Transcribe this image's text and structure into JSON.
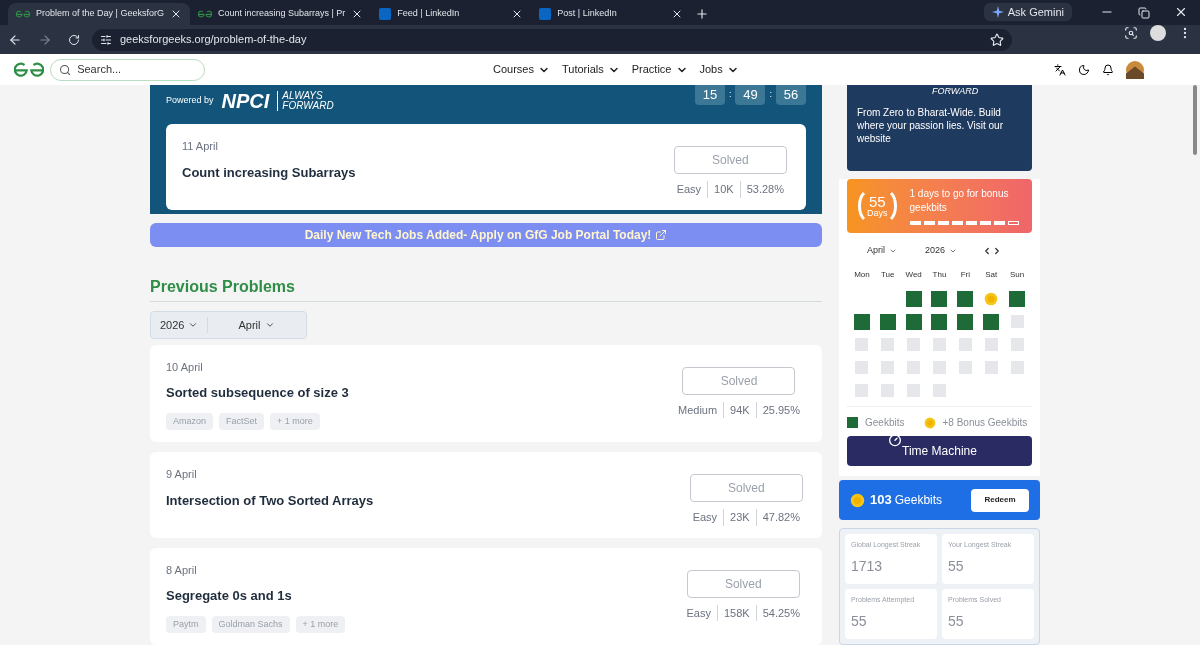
{
  "browser": {
    "tabs": [
      {
        "title": "Problem of the Day | GeeksforG",
        "kind": "gfg",
        "selected": true
      },
      {
        "title": "Count increasing Subarrays | Pr",
        "kind": "gfg",
        "selected": false
      },
      {
        "title": "Feed | LinkedIn",
        "kind": "linkedin",
        "selected": false
      },
      {
        "title": "Post | LinkedIn",
        "kind": "linkedin",
        "selected": false
      }
    ],
    "ask_gemini": "Ask Gemini",
    "address": "geeksforgeeks.org/problem-of-the-day"
  },
  "nav": {
    "search": {
      "placeholder": "Search..."
    },
    "menu": [
      "Courses",
      "Tutorials",
      "Practice",
      "Jobs"
    ]
  },
  "banner": {
    "powered_by": "Powered by",
    "sponsor": "NPCI",
    "tagline": [
      "ALWAYS",
      "FORWARD"
    ],
    "timer": [
      "15",
      "49",
      "56"
    ],
    "timer_separators": [
      ":",
      ":"
    ],
    "today": {
      "date": "11 April",
      "title": "Count increasing Subarrays",
      "status": "Solved",
      "stats": [
        "Easy",
        "10K",
        "53.28%"
      ]
    }
  },
  "jobs_banner": "Daily New Tech Jobs Added- Apply on GfG Job Portal Today!",
  "previous": {
    "heading": "Previous Problems",
    "year": "2026",
    "month": "April",
    "problems": [
      {
        "date": "10 April",
        "title": "Sorted subsequence of size 3",
        "tags": [
          "Amazon",
          "FactSet",
          "+ 1 more"
        ],
        "status": "Solved",
        "stats": [
          "Medium",
          "94K",
          "25.95%"
        ]
      },
      {
        "date": "9 April",
        "title": "Intersection of Two Sorted Arrays",
        "status": "Solved",
        "stats": [
          "Easy",
          "23K",
          "47.82%"
        ]
      },
      {
        "date": "8 April",
        "title": "Segregate 0s and 1s",
        "tags": [
          "Paytm",
          "Goldman Sachs",
          "+ 1 more"
        ],
        "status": "Solved",
        "stats": [
          "Easy",
          "158K",
          "54.25%"
        ]
      }
    ]
  },
  "ad": {
    "logo_text": "FORWARD",
    "text": "From Zero to Bharat-Wide. Build where your passion lies. Visit our website"
  },
  "streak": {
    "count": "55",
    "unit": "Days",
    "message": "1 days to go for bonus geekbits",
    "segments": [
      {
        "filled": true
      },
      {
        "filled": true
      },
      {
        "filled": true
      },
      {
        "filled": true
      },
      {
        "filled": true
      },
      {
        "filled": true
      },
      {
        "filled": true
      },
      {
        "filled": false
      }
    ]
  },
  "calendar": {
    "month": "April",
    "year": "2026",
    "weekdays": [
      "Mon",
      "Tue",
      "Wed",
      "Thu",
      "Fri",
      "Sat",
      "Sun"
    ],
    "days": [
      {
        "kind": "blank"
      },
      {
        "kind": "blank"
      },
      {
        "kind": "geekbit"
      },
      {
        "kind": "geekbit"
      },
      {
        "kind": "geekbit"
      },
      {
        "kind": "bonus"
      },
      {
        "kind": "geekbit"
      },
      {
        "kind": "geekbit"
      },
      {
        "kind": "geekbit"
      },
      {
        "kind": "geekbit"
      },
      {
        "kind": "geekbit"
      },
      {
        "kind": "geekbit"
      },
      {
        "kind": "geekbit"
      },
      {
        "kind": "none"
      },
      {
        "kind": "none"
      },
      {
        "kind": "none"
      },
      {
        "kind": "none"
      },
      {
        "kind": "none"
      },
      {
        "kind": "none"
      },
      {
        "kind": "none"
      },
      {
        "kind": "none"
      },
      {
        "kind": "none"
      },
      {
        "kind": "none"
      },
      {
        "kind": "none"
      },
      {
        "kind": "none"
      },
      {
        "kind": "none"
      },
      {
        "kind": "none"
      },
      {
        "kind": "none"
      },
      {
        "kind": "none"
      },
      {
        "kind": "none"
      },
      {
        "kind": "none"
      },
      {
        "kind": "none"
      }
    ],
    "legend": [
      "Geekbits",
      "+8 Bonus Geekbits"
    ],
    "button": "Time Machine"
  },
  "geekbits": {
    "count": "103",
    "label": "Geekbits",
    "button": "Redeem"
  },
  "stats": [
    {
      "label": "Global Longest Streak",
      "value": "1713"
    },
    {
      "label": "Your Longest Streak",
      "value": "55"
    },
    {
      "label": "Problems Attempted",
      "value": "55"
    },
    {
      "label": "Problems Solved",
      "value": "55"
    }
  ]
}
